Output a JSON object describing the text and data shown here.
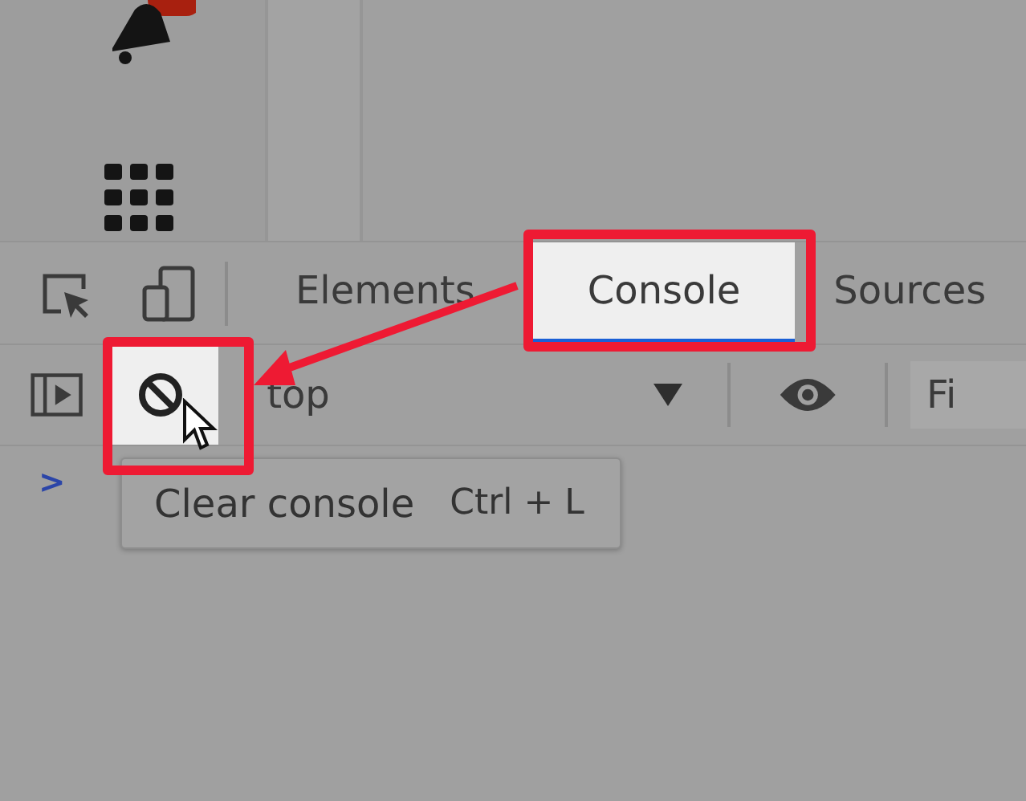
{
  "tabs": [
    {
      "label": "Elements",
      "selected": false
    },
    {
      "label": "Console",
      "selected": true
    },
    {
      "label": "Sources",
      "selected": false
    }
  ],
  "toolbar": {
    "clear_button": {
      "highlighted": true
    },
    "context": "top",
    "filter": {
      "placeholder": "Fi"
    }
  },
  "console": {
    "prompt": ">"
  },
  "tooltip": {
    "label": "Clear console",
    "shortcut": "Ctrl + L"
  }
}
